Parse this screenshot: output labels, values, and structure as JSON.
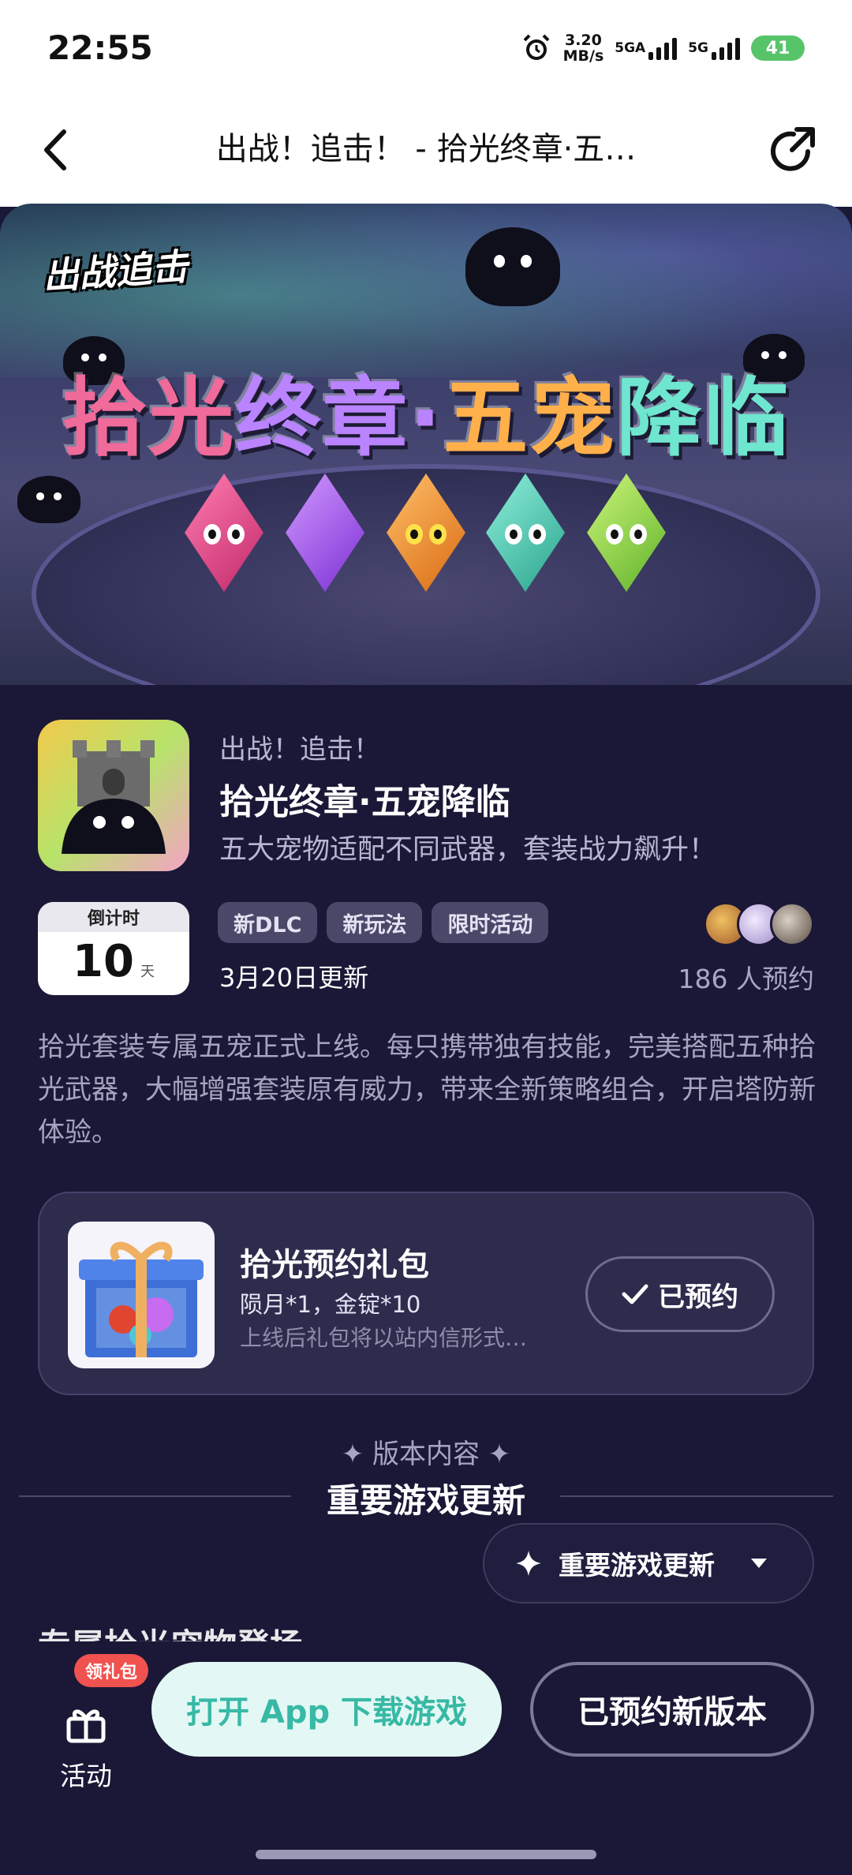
{
  "status_bar": {
    "time": "22:55",
    "net_speed_value": "3.20",
    "net_speed_unit": "MB/s",
    "sim1_label": "5GA",
    "sim2_label": "5G",
    "battery": "41",
    "icons": [
      "alarm-icon",
      "signal-icon",
      "signal-icon"
    ]
  },
  "nav": {
    "title": "出战！追击！ - 拾光终章·五…",
    "back_icon": "chevron-left-icon",
    "share_icon": "share-icon"
  },
  "banner": {
    "logo_text": "出战追击",
    "title_parts": [
      "拾光",
      "终章",
      "·",
      "五宠",
      "降临"
    ],
    "colors": [
      "#f06a9a",
      "#ba83ff",
      "#ffb04a",
      "#6fe6cf",
      "#a8ee62"
    ]
  },
  "event": {
    "game_name": "出战！追击！",
    "title": "拾光终章·五宠降临",
    "subtitle": "五大宠物适配不同武器，套装战力飙升！",
    "countdown_label": "倒计时",
    "countdown_value": "10",
    "countdown_unit": "天",
    "tags": [
      "新DLC",
      "新玩法",
      "限时活动"
    ],
    "update_date": "3月20日更新",
    "reserve_count": "186 人预约",
    "description": "拾光套装专属五宠正式上线。每只携带独有技能，完美搭配五种拾光武器，大幅增强套装原有威力，带来全新策略组合，开启塔防新体验。"
  },
  "gift": {
    "title": "拾光预约礼包",
    "items": "陨月*1，金锭*10",
    "note": "上线后礼包将以站内信形式…",
    "button_label": "已预约"
  },
  "section": {
    "kicker": "✦ 版本内容 ✦",
    "title": "重要游戏更新",
    "dropdown_label": "重要游戏更新",
    "partial_heading": "专属拾光宠物登场"
  },
  "bottom": {
    "activity_label": "活动",
    "gift_badge": "领礼包",
    "open_app_label": "打开 App 下载游戏",
    "reserved_version_label": "已预约新版本"
  },
  "colors": {
    "background": "#1a1836",
    "card": "#2e2c4d",
    "accent_teal": "#37b9a5",
    "badge_red": "#f0524f"
  }
}
